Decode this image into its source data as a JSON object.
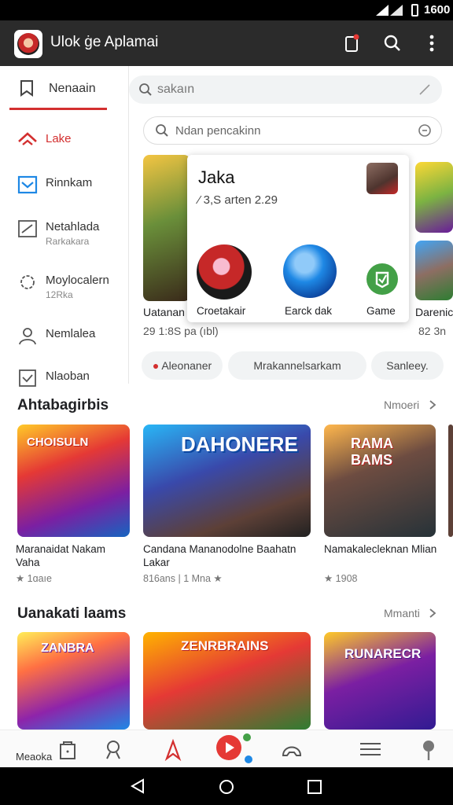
{
  "status_bar": {
    "time": "1600"
  },
  "app_bar": {
    "title": "Ulok ġe Aplamai"
  },
  "top_tab": {
    "label": "Nenaain"
  },
  "search": {
    "placeholder": "sakaın"
  },
  "search2": {
    "placeholder": "Ndan pencakinn"
  },
  "sidebar": {
    "items": [
      {
        "label": "Lake",
        "sub": ""
      },
      {
        "label": "Rinnkam",
        "sub": ""
      },
      {
        "label": "Netahlada",
        "sub": "Rarkakara"
      },
      {
        "label": "Moylocalern",
        "sub": "12Rka"
      },
      {
        "label": "Nemlalea",
        "sub": ""
      },
      {
        "label": "Nlaoban",
        "sub": ""
      }
    ]
  },
  "featured": {
    "left_caption": "Uatanan",
    "left_sub": "29 1:8S pa (ıbl)",
    "right_caption": "Darenic",
    "right_sub": "82 3n"
  },
  "popup": {
    "title": "Jaka",
    "subtitle": "⁄ 3,S arten  2.29",
    "apps": [
      {
        "label": "Croetakair"
      },
      {
        "label": "Earck dak"
      },
      {
        "label": "Game"
      }
    ]
  },
  "chips": [
    {
      "label": "Aleonaner"
    },
    {
      "label": "Mrakannelsarkam"
    },
    {
      "label": "Sanleey."
    }
  ],
  "section1": {
    "title": "Ahtabagirbis",
    "more": "Nmoeri",
    "games": [
      {
        "title": "Maranaidat Nakam Vaha",
        "rating": "★ 1ɑaıe",
        "art": "CHOISULN"
      },
      {
        "title": "Candana Mananodolne Baahatn Lakar",
        "rating": "816ans  |  1 Mna ★",
        "art": "DAHONERE"
      },
      {
        "title": "Namakalecleknan Mlian",
        "rating": "★ 1908",
        "art": "RAMA BAMS"
      }
    ]
  },
  "section2": {
    "title": "Uanakati laams",
    "more": "Mmanti",
    "games": [
      {
        "title": "Meaoka",
        "art": "ZANBRA"
      },
      {
        "title": "",
        "art": "ZENRBRAINS"
      },
      {
        "title": "",
        "art": "RUNARECR"
      }
    ]
  },
  "colors": {
    "accent": "#d32f2f",
    "appbar": "#2b2b2b",
    "chip_bg": "#f1f3f4"
  }
}
